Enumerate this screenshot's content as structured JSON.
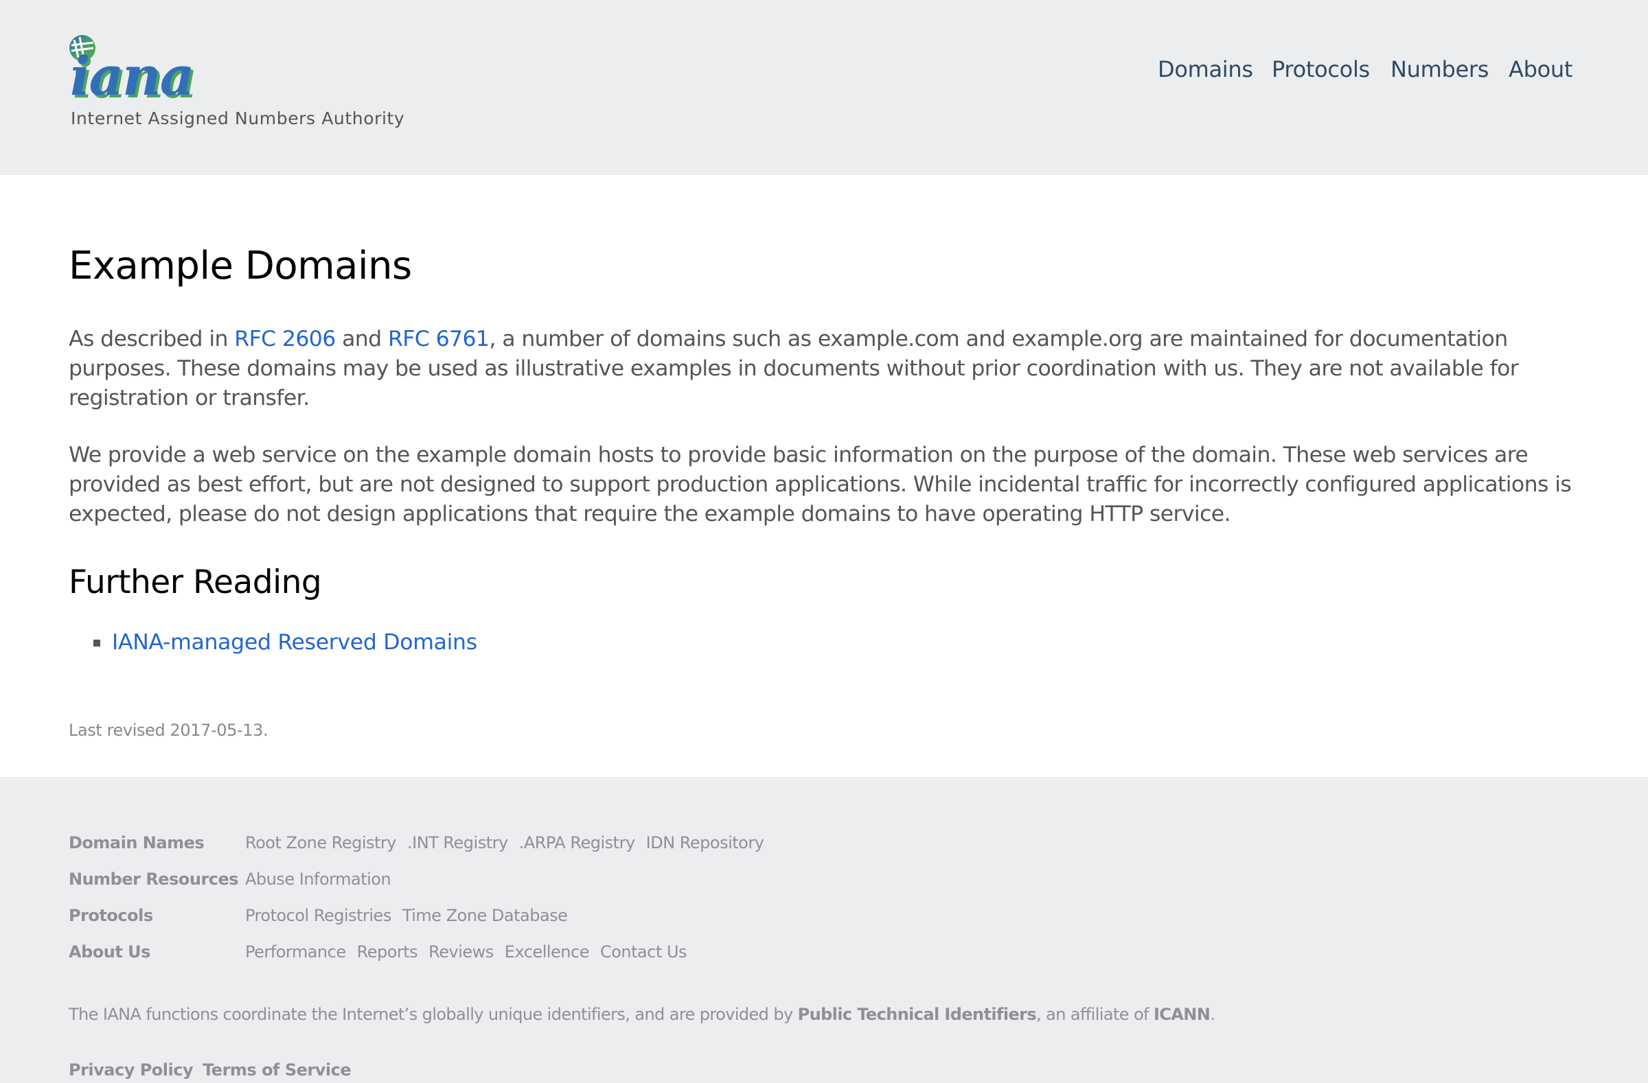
{
  "header": {
    "logo_text": "iana",
    "tagline": "Internet Assigned Numbers Authority",
    "nav": [
      {
        "label": "Domains"
      },
      {
        "label": "Protocols"
      },
      {
        "label": "Numbers"
      },
      {
        "label": "About"
      }
    ]
  },
  "main": {
    "title": "Example Domains",
    "p1": {
      "pre": "As described in ",
      "link1": "RFC 2606",
      "mid": " and ",
      "link2": "RFC 6761",
      "post": ", a number of domains such as example.com and example.org are maintained for documentation purposes. These domains may be used as illustrative examples in documents without prior coordination with us. They are not available for registration or transfer."
    },
    "p2": "We provide a web service on the example domain hosts to provide basic information on the purpose of the domain. These web services are provided as best effort, but are not designed to support production applications. While incidental traffic for incorrectly configured applications is expected, please do not design applications that require the example domains to have operating HTTP service.",
    "further_reading_title": "Further Reading",
    "further_reading": [
      {
        "label": "IANA-managed Reserved Domains"
      }
    ],
    "last_revised": "Last revised 2017-05-13."
  },
  "footer": {
    "rows": [
      {
        "label": "Domain Names",
        "links": [
          "Root Zone Registry",
          ".INT Registry",
          ".ARPA Registry",
          "IDN Repository"
        ]
      },
      {
        "label": "Number Resources",
        "links": [
          "Abuse Information"
        ]
      },
      {
        "label": "Protocols",
        "links": [
          "Protocol Registries",
          "Time Zone Database"
        ]
      },
      {
        "label": "About Us",
        "links": [
          "Performance",
          "Reports",
          "Reviews",
          "Excellence",
          "Contact Us"
        ]
      }
    ],
    "note": {
      "pre": "The IANA functions coordinate the Internet’s globally unique identifiers, and are provided by ",
      "bold1": "Public Technical Identifiers",
      "mid": ", an affiliate of ",
      "bold2": "ICANN",
      "post": "."
    },
    "legal": [
      "Privacy Policy",
      "Terms of Service"
    ]
  },
  "colors": {
    "link": "#2266cc",
    "nav": "#2f4a64",
    "band_bg": "#ecedef",
    "logo_blue": "#3170b8",
    "logo_green": "#4ea35a"
  }
}
